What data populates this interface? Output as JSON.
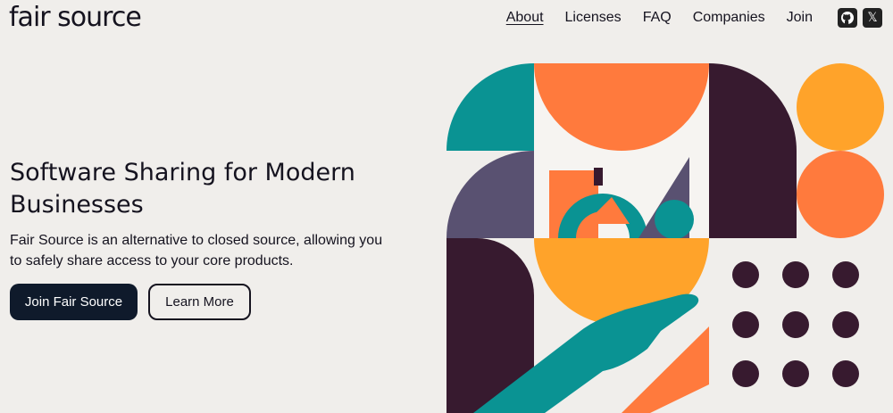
{
  "header": {
    "logo": "fair source",
    "nav": [
      {
        "label": "About",
        "active": true
      },
      {
        "label": "Licenses",
        "active": false
      },
      {
        "label": "FAQ",
        "active": false
      },
      {
        "label": "Companies",
        "active": false
      },
      {
        "label": "Join",
        "active": false
      }
    ],
    "social": {
      "github_icon": "github-icon",
      "x_icon": "x-icon",
      "x_glyph": "𝕏"
    }
  },
  "hero": {
    "title": "Software Sharing for Modern Businesses",
    "subtitle": "Fair Source is an alternative to closed source, allowing you to safely share access to your core products.",
    "primary_button": "Join Fair Source",
    "secondary_button": "Learn More"
  },
  "colors": {
    "teal": "#0a9393",
    "orange": "#ff7a3d",
    "amber": "#ffa32a",
    "plum": "#371a2f",
    "slate": "#595171",
    "navy": "#0f1a2b"
  }
}
